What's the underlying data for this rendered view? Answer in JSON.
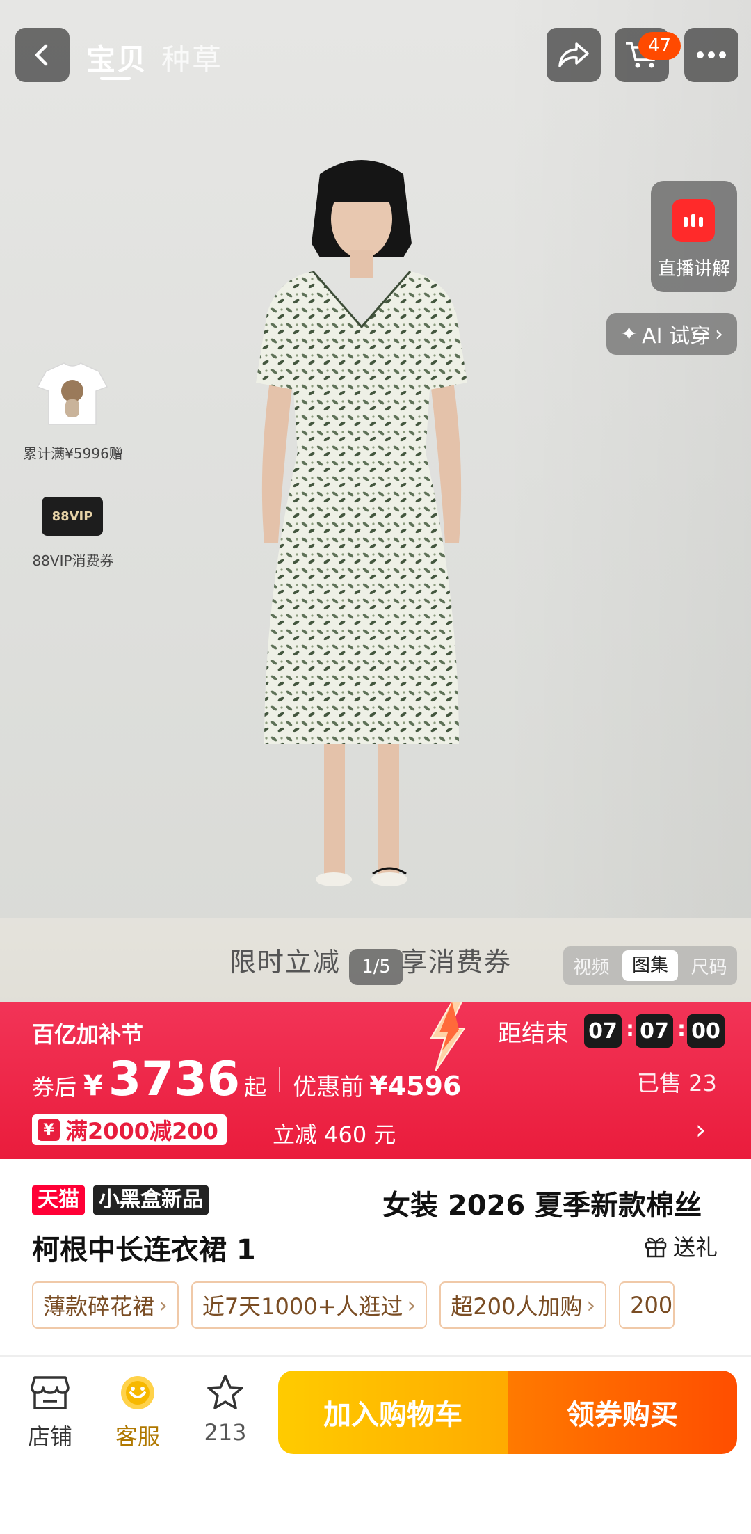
{
  "top_bar": {
    "tabs": [
      "宝贝",
      "种草"
    ],
    "cart_count": "47"
  },
  "hero": {
    "live_label": "直播讲解",
    "ai_tryon_label": "AI 试穿",
    "gift_promo_text": "累计满¥5996赠",
    "vip_card_label": "88VIP",
    "vip_coupon_text": "88VIP消费券",
    "limit_text": "限时立减",
    "limit_text_tail": "享消费券",
    "page_indicator": "1/5",
    "media_tabs": [
      "视频",
      "图集",
      "尺码"
    ],
    "active_media_tab": "图集"
  },
  "promo": {
    "festival_label": "百亿加补节",
    "countdown_label": "距结束",
    "countdown": [
      "07",
      "07",
      "00"
    ],
    "after_coupon_label": "券后",
    "currency": "¥",
    "price": "3736",
    "price_suffix": "起",
    "original_label": "优惠前",
    "original_price": "¥4596",
    "sold_text": "已售 23",
    "coupon_icon": "¥",
    "coupon_text": "满2000减200",
    "instant_discount": "立减 460 元"
  },
  "product": {
    "badge_tmall": "天猫",
    "badge_new": "小黑盒新品",
    "title_line1": "女装 2026 夏季新款棉丝",
    "title_line2": "柯根中长连衣裙 1",
    "gift_label": "送礼",
    "tags": [
      "薄款碎花裙",
      "近7天1000+人逛过",
      "超200人加购",
      "200"
    ]
  },
  "bottom_bar": {
    "store_label": "店铺",
    "service_label": "客服",
    "favorite_count": "213",
    "add_to_cart_label": "加入购物车",
    "buy_label": "领券购买"
  },
  "colors": {
    "promo_red": "#ea1c3c",
    "cart_yellow": "#ffb800",
    "buy_orange": "#ff5a00",
    "tmall_red": "#ff0036"
  }
}
